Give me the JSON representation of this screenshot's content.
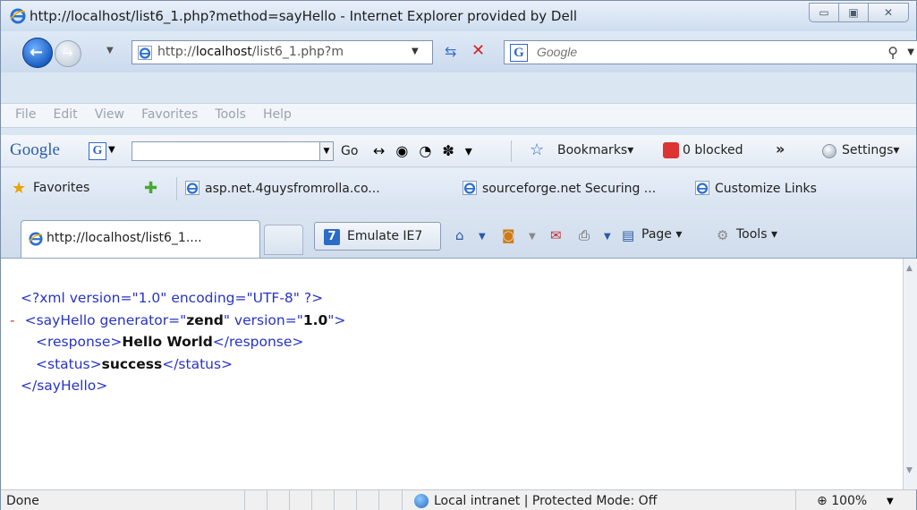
{
  "window": {
    "title": "http://localhost/list6_1.php?method=sayHello - Internet Explorer provided by Dell",
    "minimize_glyph": "▭",
    "maximize_glyph": "▣",
    "close_glyph": "✕"
  },
  "address": {
    "url_prefix": "http://",
    "url_host": "localhost",
    "url_rest": "/list6_1.php?m",
    "search_placeholder": "Google"
  },
  "menu": [
    "File",
    "Edit",
    "View",
    "Favorites",
    "Tools",
    "Help"
  ],
  "google_toolbar": {
    "logo": "Google",
    "go_label": "Go",
    "bookmarks_label": "Bookmarks▾",
    "blocked_label": "0 blocked",
    "more_label": "»",
    "settings_label": "Settings▾"
  },
  "favorites_bar": {
    "favorites_label": "Favorites",
    "links": [
      "asp.net.4guysfromrolla.co...",
      "sourceforge.net Securing ...",
      "Customize Links"
    ]
  },
  "tabs": {
    "active_tab_label": "http://localhost/list6_1....",
    "emulate_icon": "7",
    "emulate_label": "Emulate IE7",
    "page_label": "Page ▾",
    "tools_label": "Tools ▾"
  },
  "xml_doc": {
    "line1": "<?xml version=\"1.0\" encoding=\"UTF-8\" ?>",
    "minus": "-",
    "root_open_start": "<sayHello generator=\"",
    "generator": "zend",
    "root_mid": "\" version=\"",
    "version": "1.0",
    "root_open_end": "\">",
    "response_open": "<response>",
    "response_value": "Hello World",
    "response_close": "</response>",
    "status_open": "<status>",
    "status_value": "success",
    "status_close": "</status>",
    "root_close": "</sayHello>"
  },
  "statusbar": {
    "done": "Done",
    "zone": "Local intranet | Protected Mode: Off",
    "zoom": "100%"
  }
}
